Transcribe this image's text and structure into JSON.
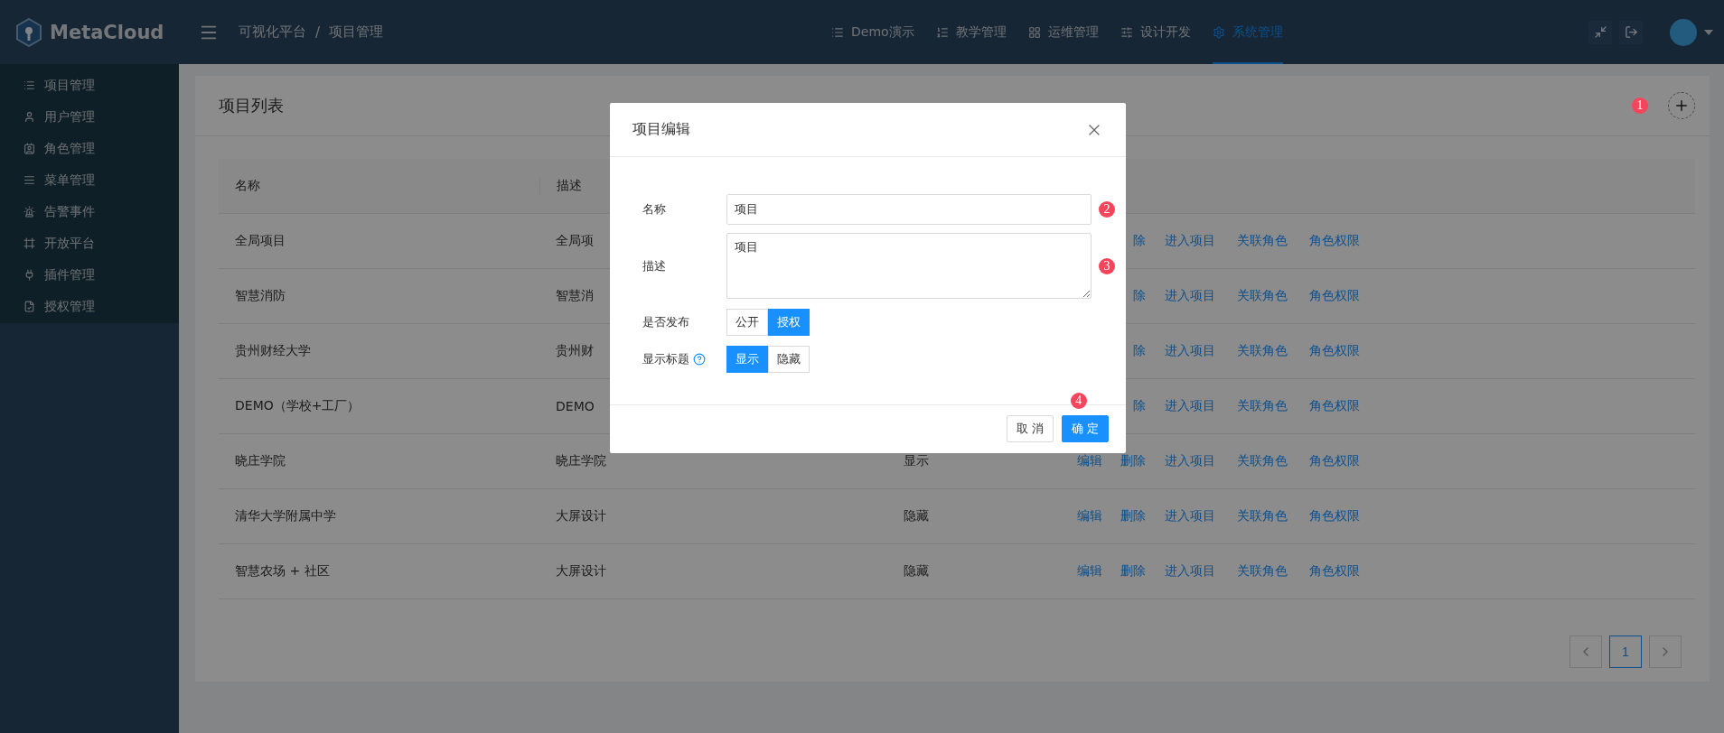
{
  "brand": {
    "name": "MetaCloud"
  },
  "breadcrumb": {
    "items": [
      "可视化平台",
      "项目管理"
    ],
    "separator": "/"
  },
  "nav": [
    {
      "label": "Demo演示",
      "selected": false
    },
    {
      "label": "教学管理",
      "selected": false
    },
    {
      "label": "运维管理",
      "selected": false
    },
    {
      "label": "设计开发",
      "selected": false
    },
    {
      "label": "系统管理",
      "selected": true
    }
  ],
  "sidebar": {
    "items": [
      {
        "label": "项目管理"
      },
      {
        "label": "用户管理"
      },
      {
        "label": "角色管理"
      },
      {
        "label": "菜单管理"
      },
      {
        "label": "告警事件"
      },
      {
        "label": "开放平台"
      },
      {
        "label": "插件管理"
      },
      {
        "label": "授权管理"
      }
    ]
  },
  "page": {
    "title": "项目列表",
    "marker": "1",
    "columns": [
      "名称",
      "描述"
    ],
    "rows": [
      {
        "name": "全局项目",
        "description": "全局项",
        "actions": [
          {
            "kind": "delete-cut",
            "label": "除"
          },
          {
            "kind": "enter",
            "label": "进入项目"
          },
          {
            "kind": "roles",
            "label": "关联角色"
          },
          {
            "kind": "permissions",
            "label": "角色权限"
          }
        ]
      },
      {
        "name": "智慧消防",
        "description": "智慧消",
        "actions": [
          {
            "kind": "delete-cut",
            "label": "除"
          },
          {
            "kind": "enter",
            "label": "进入项目"
          },
          {
            "kind": "roles",
            "label": "关联角色"
          },
          {
            "kind": "permissions",
            "label": "角色权限"
          }
        ]
      },
      {
        "name": "贵州财经大学",
        "description": "贵州财",
        "actions": [
          {
            "kind": "delete-cut",
            "label": "除"
          },
          {
            "kind": "enter",
            "label": "进入项目"
          },
          {
            "kind": "roles",
            "label": "关联角色"
          },
          {
            "kind": "permissions",
            "label": "角色权限"
          }
        ]
      },
      {
        "name": "DEMO（学校+工厂）",
        "description": "DEMO",
        "actions": [
          {
            "kind": "delete-cut",
            "label": "除"
          },
          {
            "kind": "enter",
            "label": "进入项目"
          },
          {
            "kind": "roles",
            "label": "关联角色"
          },
          {
            "kind": "permissions",
            "label": "角色权限"
          }
        ]
      },
      {
        "name": "晓庄学院",
        "description": "晓庄学院",
        "status": "显示",
        "actions": [
          {
            "kind": "edit",
            "label": "编辑"
          },
          {
            "kind": "delete",
            "label": "删除"
          },
          {
            "kind": "enter",
            "label": "进入项目"
          },
          {
            "kind": "roles",
            "label": "关联角色"
          },
          {
            "kind": "permissions",
            "label": "角色权限"
          }
        ]
      },
      {
        "name": "清华大学附属中学",
        "description": "大屏设计",
        "status": "隐藏",
        "actions": [
          {
            "kind": "edit",
            "label": "编辑"
          },
          {
            "kind": "delete",
            "label": "删除"
          },
          {
            "kind": "enter",
            "label": "进入项目"
          },
          {
            "kind": "roles",
            "label": "关联角色"
          },
          {
            "kind": "permissions",
            "label": "角色权限"
          }
        ]
      },
      {
        "name": "智慧农场 + 社区",
        "description": "大屏设计",
        "status": "隐藏",
        "actions": [
          {
            "kind": "edit",
            "label": "编辑"
          },
          {
            "kind": "delete",
            "label": "删除"
          },
          {
            "kind": "enter",
            "label": "进入项目"
          },
          {
            "kind": "roles",
            "label": "关联角色"
          },
          {
            "kind": "permissions",
            "label": "角色权限"
          }
        ]
      }
    ],
    "pagination": {
      "pages": [
        {
          "label": "1",
          "selected": true
        }
      ]
    }
  },
  "modal": {
    "title": "项目编辑",
    "fields": [
      {
        "kind": "text",
        "label": "名称",
        "value": "项目",
        "marker": "2"
      },
      {
        "kind": "textarea",
        "label": "描述",
        "value": "项目",
        "marker": "3"
      },
      {
        "kind": "segmented",
        "label": "是否发布",
        "options": [
          {
            "label": "公开",
            "selected": false
          },
          {
            "label": "授权",
            "selected": true
          }
        ]
      },
      {
        "kind": "segmented",
        "label": "显示标题",
        "help": true,
        "options": [
          {
            "label": "显示",
            "selected": true
          },
          {
            "label": "隐藏",
            "selected": false
          }
        ]
      }
    ],
    "buttons": [
      {
        "label": "取 消",
        "kind": "default"
      },
      {
        "label": "确 定",
        "kind": "primary",
        "marker": "4"
      }
    ]
  }
}
